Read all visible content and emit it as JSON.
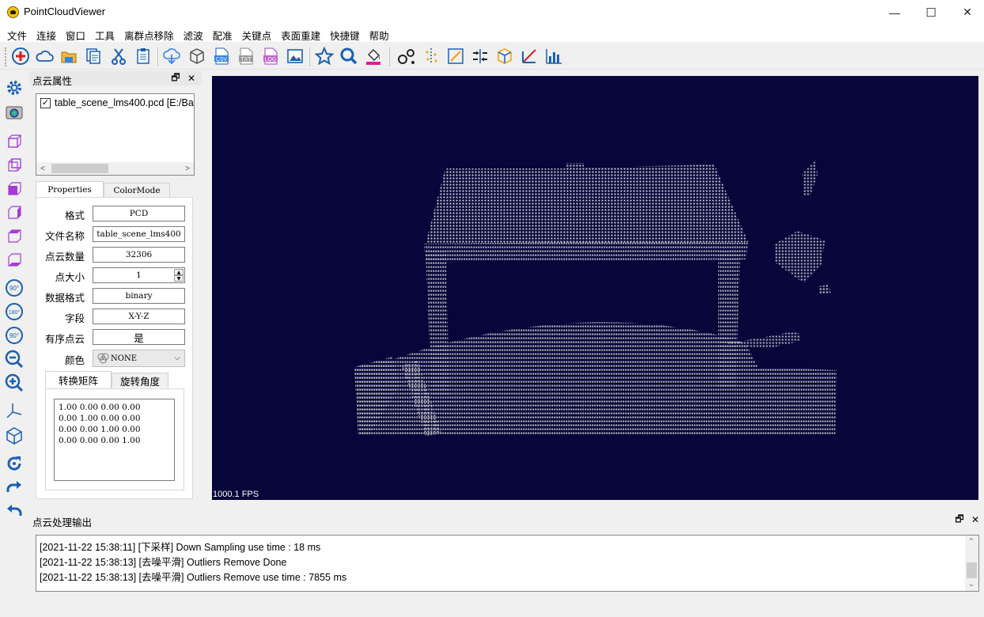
{
  "window": {
    "title": "PointCloudViewer",
    "minimize_glyph": "—",
    "maximize_glyph": "☐",
    "close_glyph": "✕"
  },
  "menu": [
    "文件",
    "连接",
    "窗口",
    "工具",
    "离群点移除",
    "滤波",
    "配准",
    "关键点",
    "表面重建",
    "快捷键",
    "帮助"
  ],
  "toolbar_icons": [
    "add-icon",
    "cloud-icon",
    "open-folder-icon",
    "copy-icon",
    "cut-icon",
    "paste-icon",
    "download-icon",
    "box-icon",
    "csv-icon",
    "txt-icon",
    "log-icon",
    "image-icon",
    "star-icon",
    "search-icon",
    "fill-color-icon",
    "connect-points-icon",
    "keypoints-icon",
    "measure-icon",
    "align-icon",
    "cube-icon",
    "axis-icon",
    "histogram-icon"
  ],
  "toolbar_text": {
    "csv": "CSV",
    "txt": "TXT",
    "log": "LOG"
  },
  "left_toolbar_icons": [
    "settings-gear-icon",
    "camera-icon",
    "view-front-icon",
    "view-back-icon",
    "view-left-icon",
    "view-right-icon",
    "view-top-icon",
    "view-bottom-icon",
    "rotate-90-icon",
    "rotate-180-icon",
    "rotate-neg-90-icon",
    "zoom-out-icon",
    "zoom-in-icon",
    "axes-icon",
    "iso-view-icon",
    "refresh-icon",
    "redo-icon",
    "undo-icon"
  ],
  "left_toolbar_text": {
    "r90": "90°",
    "r180": "180°",
    "rn90": "90°"
  },
  "properties_dock": {
    "title": "点云属性",
    "float_glyph": "🗗",
    "close_glyph": "✕",
    "file_item": "table_scene_lms400.pcd [E:/Ba",
    "file_checked": "✓",
    "scroll_left": "<",
    "scroll_right": ">",
    "tabs": [
      "Properties",
      "ColorMode"
    ],
    "fields": [
      {
        "label": "格式",
        "value": "PCD"
      },
      {
        "label": "文件名称",
        "value": "table_scene_lms400"
      },
      {
        "label": "点云数量",
        "value": "32306"
      },
      {
        "label": "点大小",
        "value": "1"
      },
      {
        "label": "数据格式",
        "value": "binary"
      },
      {
        "label": "字段",
        "value": "X-Y-Z"
      },
      {
        "label": "有序点云",
        "value": "是"
      }
    ],
    "color_label": "颜色",
    "color_value": "NONE",
    "sub_tabs": [
      "转换矩阵",
      "旋转角度"
    ],
    "matrix": "1.00 0.00 0.00 0.00\n0.00 1.00 0.00 0.00\n0.00 0.00 1.00 0.00\n0.00 0.00 0.00 1.00"
  },
  "viewport": {
    "fps": "1000.1 FPS",
    "background": "#06063a",
    "point_color": "#d8d8d8"
  },
  "output_dock": {
    "title": "点云处理输出",
    "float_glyph": "🗗",
    "close_glyph": "✕",
    "lines": [
      "[2021-11-22 15:38:11] [下采样] Down Sampling use time : 18 ms",
      "[2021-11-22 15:38:13] [去噪平滑] Outliers Remove Done",
      "[2021-11-22 15:38:13] [去噪平滑] Outliers Remove use time : 7855 ms"
    ]
  },
  "colors": {
    "accent_blue": "#1a5fb4",
    "accent_red": "#e01b24",
    "icon_purple": "#a43bd6"
  }
}
